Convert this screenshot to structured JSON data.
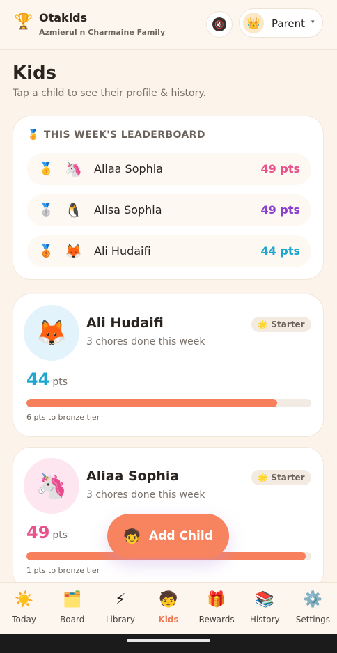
{
  "header": {
    "app_icon": "trophy-icon",
    "app_icon_glyph": "🏆",
    "app_name": "Otakids",
    "family_name": "Azmierul n Charmaine Family",
    "mute_icon": "sound-off-icon",
    "mute_glyph": "🔇",
    "parent_avatar": "crown-icon",
    "parent_avatar_glyph": "👑",
    "parent_label": "Parent",
    "parent_caret": "▾"
  },
  "page": {
    "title": "Kids",
    "subtitle": "Tap a child to see their profile & history."
  },
  "leaderboard": {
    "icon": "medal-icon",
    "icon_glyph": "🏅",
    "title": "THIS WEEK'S LEADERBOARD",
    "rows": [
      {
        "medal": "gold-medal-icon",
        "medal_glyph": "🥇",
        "avatar": "unicorn-icon",
        "avatar_glyph": "🦄",
        "name": "Aliaa Sophia",
        "points": "49 pts",
        "color": "#e8538c"
      },
      {
        "medal": "silver-medal-icon",
        "medal_glyph": "🥈",
        "avatar": "penguin-icon",
        "avatar_glyph": "🐧",
        "name": "Alisa Sophia",
        "points": "49 pts",
        "color": "#8a3fd1"
      },
      {
        "medal": "bronze-medal-icon",
        "medal_glyph": "🥉",
        "avatar": "fox-icon",
        "avatar_glyph": "🦊",
        "name": "Ali Hudaifi",
        "points": "44 pts",
        "color": "#1fa6cf"
      }
    ]
  },
  "kids": [
    {
      "name": "Ali Hudaifi",
      "avatar": "fox-icon",
      "avatar_glyph": "🦊",
      "avatar_bg": "#e3f3fb",
      "chores": "3 chores done this week",
      "tier_icon": "star-icon",
      "tier_glyph": "🌟",
      "tier": "Starter",
      "points": "44",
      "points_unit": "pts",
      "points_color": "#1fa6cf",
      "progress_percent": 88,
      "note": "6 pts to bronze tier"
    },
    {
      "name": "Aliaa Sophia",
      "avatar": "unicorn-icon",
      "avatar_glyph": "🦄",
      "avatar_bg": "#fde6ef",
      "chores": "3 chores done this week",
      "tier_icon": "star-icon",
      "tier_glyph": "🌟",
      "tier": "Starter",
      "points": "49",
      "points_unit": "pts",
      "points_color": "#e8538c",
      "progress_percent": 98,
      "note": "1 pts to bronze tier"
    }
  ],
  "fab": {
    "icon": "child-icon",
    "icon_glyph": "🧒",
    "label": "Add Child"
  },
  "nav": [
    {
      "key": "today",
      "icon": "sun-icon",
      "glyph": "☀️",
      "label": "Today",
      "active": false
    },
    {
      "key": "board",
      "icon": "board-icon",
      "glyph": "🗂️",
      "label": "Board",
      "active": false
    },
    {
      "key": "library",
      "icon": "lightning-icon",
      "glyph": "⚡",
      "label": "Library",
      "active": false
    },
    {
      "key": "kids",
      "icon": "child-icon",
      "glyph": "🧒",
      "label": "Kids",
      "active": true
    },
    {
      "key": "rewards",
      "icon": "gift-icon",
      "glyph": "🎁",
      "label": "Rewards",
      "active": false
    },
    {
      "key": "history",
      "icon": "books-icon",
      "glyph": "📚",
      "label": "History",
      "active": false
    },
    {
      "key": "settings",
      "icon": "gear-icon",
      "glyph": "⚙️",
      "label": "Settings",
      "active": false
    }
  ]
}
